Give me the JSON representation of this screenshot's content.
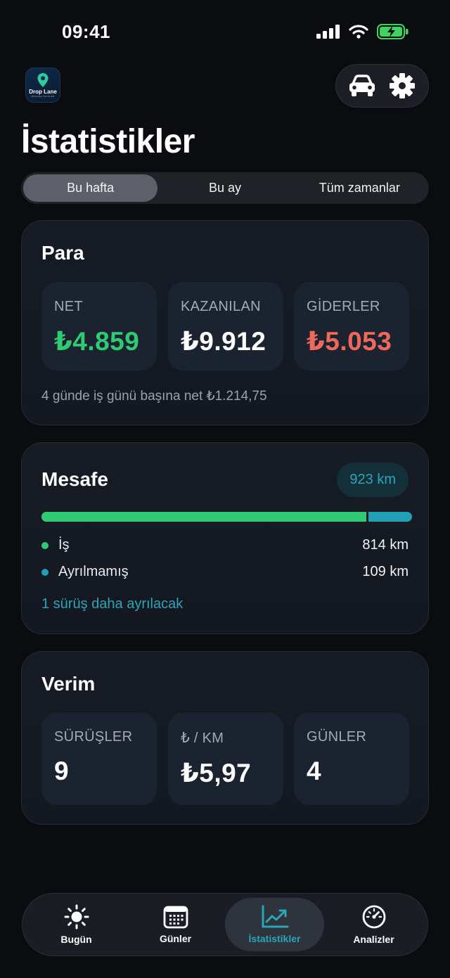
{
  "status_bar": {
    "time": "09:41"
  },
  "app": {
    "logo_text": "Drop Lane",
    "logo_sub": "MILEAGE TRACKER"
  },
  "header": {
    "title": "İstatistikler",
    "actions": [
      "car-icon",
      "gear-icon"
    ]
  },
  "segmented": {
    "options": [
      "Bu hafta",
      "Bu ay",
      "Tüm zamanlar"
    ],
    "selected": "Bu hafta"
  },
  "money_card": {
    "title": "Para",
    "tiles": [
      {
        "label": "NET",
        "value": "₺4.859",
        "color": "#2fcb73"
      },
      {
        "label": "KAZANILAN",
        "value": "₺9.912",
        "color": "#ffffff"
      },
      {
        "label": "GİDERLER",
        "value": "₺5.053",
        "color": "#f0685a"
      }
    ],
    "footnote": "4 günde iş günü başına net ₺1.214,75"
  },
  "distance_card": {
    "title": "Mesafe",
    "total": "923 km",
    "business_fraction": 0.882,
    "rows": [
      {
        "label": "İş",
        "value": "814 km",
        "color": "#2fcb73"
      },
      {
        "label": "Ayrılmamış",
        "value": "109 km",
        "color": "#1fa0b5"
      }
    ],
    "link": "1 sürüş daha ayrılacak"
  },
  "efficiency_card": {
    "title": "Verim",
    "tiles": [
      {
        "label": "SÜRÜŞLER",
        "value": "9"
      },
      {
        "label": "₺ / KM",
        "value": "₺5,97"
      },
      {
        "label": "GÜNLER",
        "value": "4"
      }
    ]
  },
  "tabbar": {
    "tabs": [
      {
        "label": "Bugün",
        "icon": "sun-icon"
      },
      {
        "label": "Günler",
        "icon": "calendar-icon"
      },
      {
        "label": "İstatistikler",
        "icon": "chart-icon"
      },
      {
        "label": "Analizler",
        "icon": "gauge-icon"
      }
    ],
    "active": "İstatistikler"
  },
  "colors": {
    "accent": "#2aa6b8",
    "positive": "#2fcb73",
    "negative": "#f0685a",
    "background": "#0a0c10"
  }
}
